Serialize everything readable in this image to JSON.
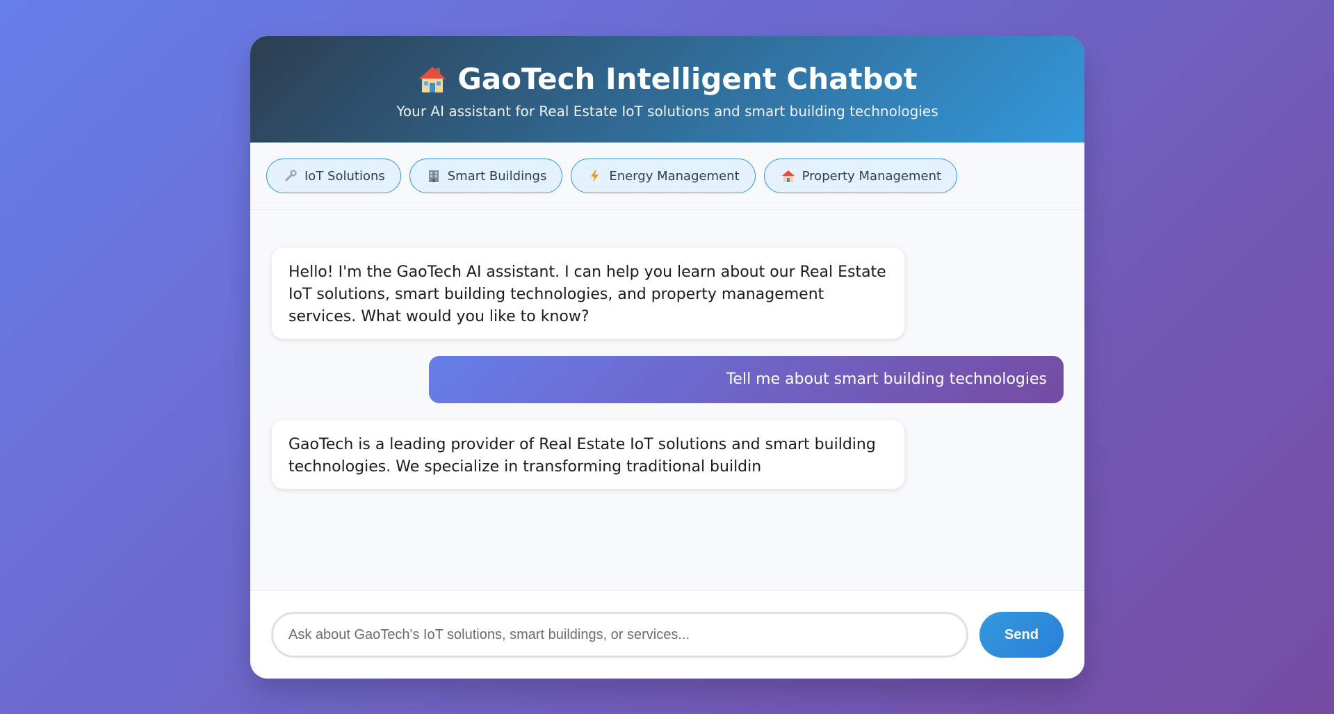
{
  "header": {
    "title": "GaoTech Intelligent Chatbot",
    "subtitle": "Your AI assistant for Real Estate IoT solutions and smart building technologies",
    "icon": "house-icon"
  },
  "quick_topics": [
    {
      "label": "IoT Solutions",
      "icon": "wrench-icon"
    },
    {
      "label": "Smart Buildings",
      "icon": "office-building-icon"
    },
    {
      "label": "Energy Management",
      "icon": "lightning-icon"
    },
    {
      "label": "Property Management",
      "icon": "house-icon"
    }
  ],
  "messages": [
    {
      "role": "bot",
      "text": "Hello! I'm the GaoTech AI assistant. I can help you learn about our Real Estate IoT solutions, smart building technologies, and property management services. What would you like to know?"
    },
    {
      "role": "user",
      "text": "Tell me about smart building technologies"
    },
    {
      "role": "bot",
      "text": "GaoTech is a leading provider of Real Estate IoT solutions and smart building technologies. We specialize in transforming traditional buildin"
    }
  ],
  "input": {
    "placeholder": "Ask about GaoTech's IoT solutions, smart buildings, or services...",
    "value": ""
  },
  "send_label": "Send",
  "colors": {
    "header_start": "#2c3e50",
    "header_end": "#3498db",
    "user_bubble_start": "#667eea",
    "user_bubble_end": "#764ba2",
    "accent": "#3498db"
  }
}
